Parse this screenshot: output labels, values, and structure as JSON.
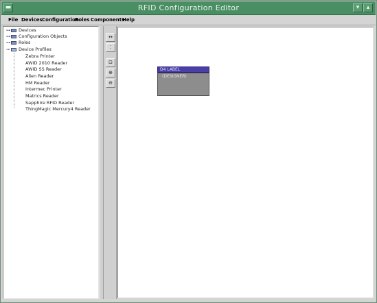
{
  "window": {
    "title": "RFID Configuration Editor",
    "sys_menu_glyph": "▬",
    "minimize_glyph": "▾",
    "close_glyph": "▴"
  },
  "menubar": {
    "items": [
      "File",
      "Devices",
      "Configuration",
      "Roles",
      "Components",
      "Help"
    ]
  },
  "tree": {
    "roots": [
      {
        "label": "Devices",
        "expander": "⊶"
      },
      {
        "label": "Configuration Objects",
        "expander": "⊶"
      },
      {
        "label": "Roles",
        "expander": "⊶"
      },
      {
        "label": "Device Profiles",
        "expander": "⊸"
      }
    ],
    "profiles": [
      "Zebra Printer",
      "AWID 2010 Reader",
      "AWID SS Reader",
      "Alien Reader",
      "HM Reader",
      "Intermec Printer",
      "Matrics Reader",
      "Sapphire RFID Reader",
      "ThingMagic Mercury4 Reader"
    ]
  },
  "toolbar": {
    "buttons": [
      {
        "name": "select-tool",
        "glyph": "↔"
      },
      {
        "name": "connect-tool",
        "glyph": "⁚"
      },
      {
        "name": "zoom-fit-tool",
        "glyph": "⊡"
      },
      {
        "name": "zoom-in-tool",
        "glyph": "⊕"
      },
      {
        "name": "zoom-out-tool",
        "glyph": "⊖"
      }
    ]
  },
  "canvas": {
    "node": {
      "header": "D4 LABEL",
      "body": "(DESIGNER)"
    }
  },
  "colors": {
    "titlebar": "#4a8f64",
    "node_header": "#4a3fa8",
    "node_body": "#8d8d8d"
  }
}
